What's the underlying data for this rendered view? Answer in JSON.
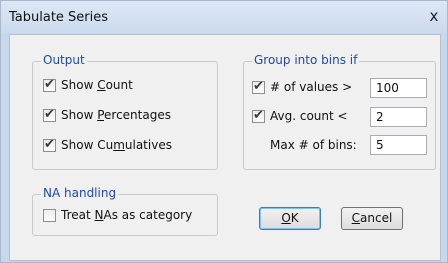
{
  "window": {
    "title": "Tabulate Series",
    "close_glyph": "x"
  },
  "output": {
    "legend": "Output",
    "items": [
      {
        "prefix": "Show ",
        "accel": "C",
        "suffix": "ount",
        "checked": true
      },
      {
        "prefix": "Show ",
        "accel": "P",
        "suffix": "ercentages",
        "checked": true
      },
      {
        "prefix": "Show Cu",
        "accel": "m",
        "suffix": "ulatives",
        "checked": true
      }
    ]
  },
  "bins": {
    "legend": "Group into bins if",
    "num_values_label": "# of values >",
    "num_values": "100",
    "num_values_checked": true,
    "avg_count_label": "Avg. count <",
    "avg_count": "2",
    "avg_count_checked": true,
    "max_bins_label": "Max # of bins:",
    "max_bins": "5"
  },
  "na": {
    "legend": "NA handling",
    "item": {
      "prefix": "Treat ",
      "accel": "N",
      "suffix": "As as category",
      "checked": false
    }
  },
  "buttons": {
    "ok": {
      "accel": "O",
      "suffix": "K"
    },
    "cancel": {
      "accel": "C",
      "suffix": "ancel"
    }
  },
  "icons": {
    "check": "check-mark-icon",
    "close": "close-icon"
  }
}
